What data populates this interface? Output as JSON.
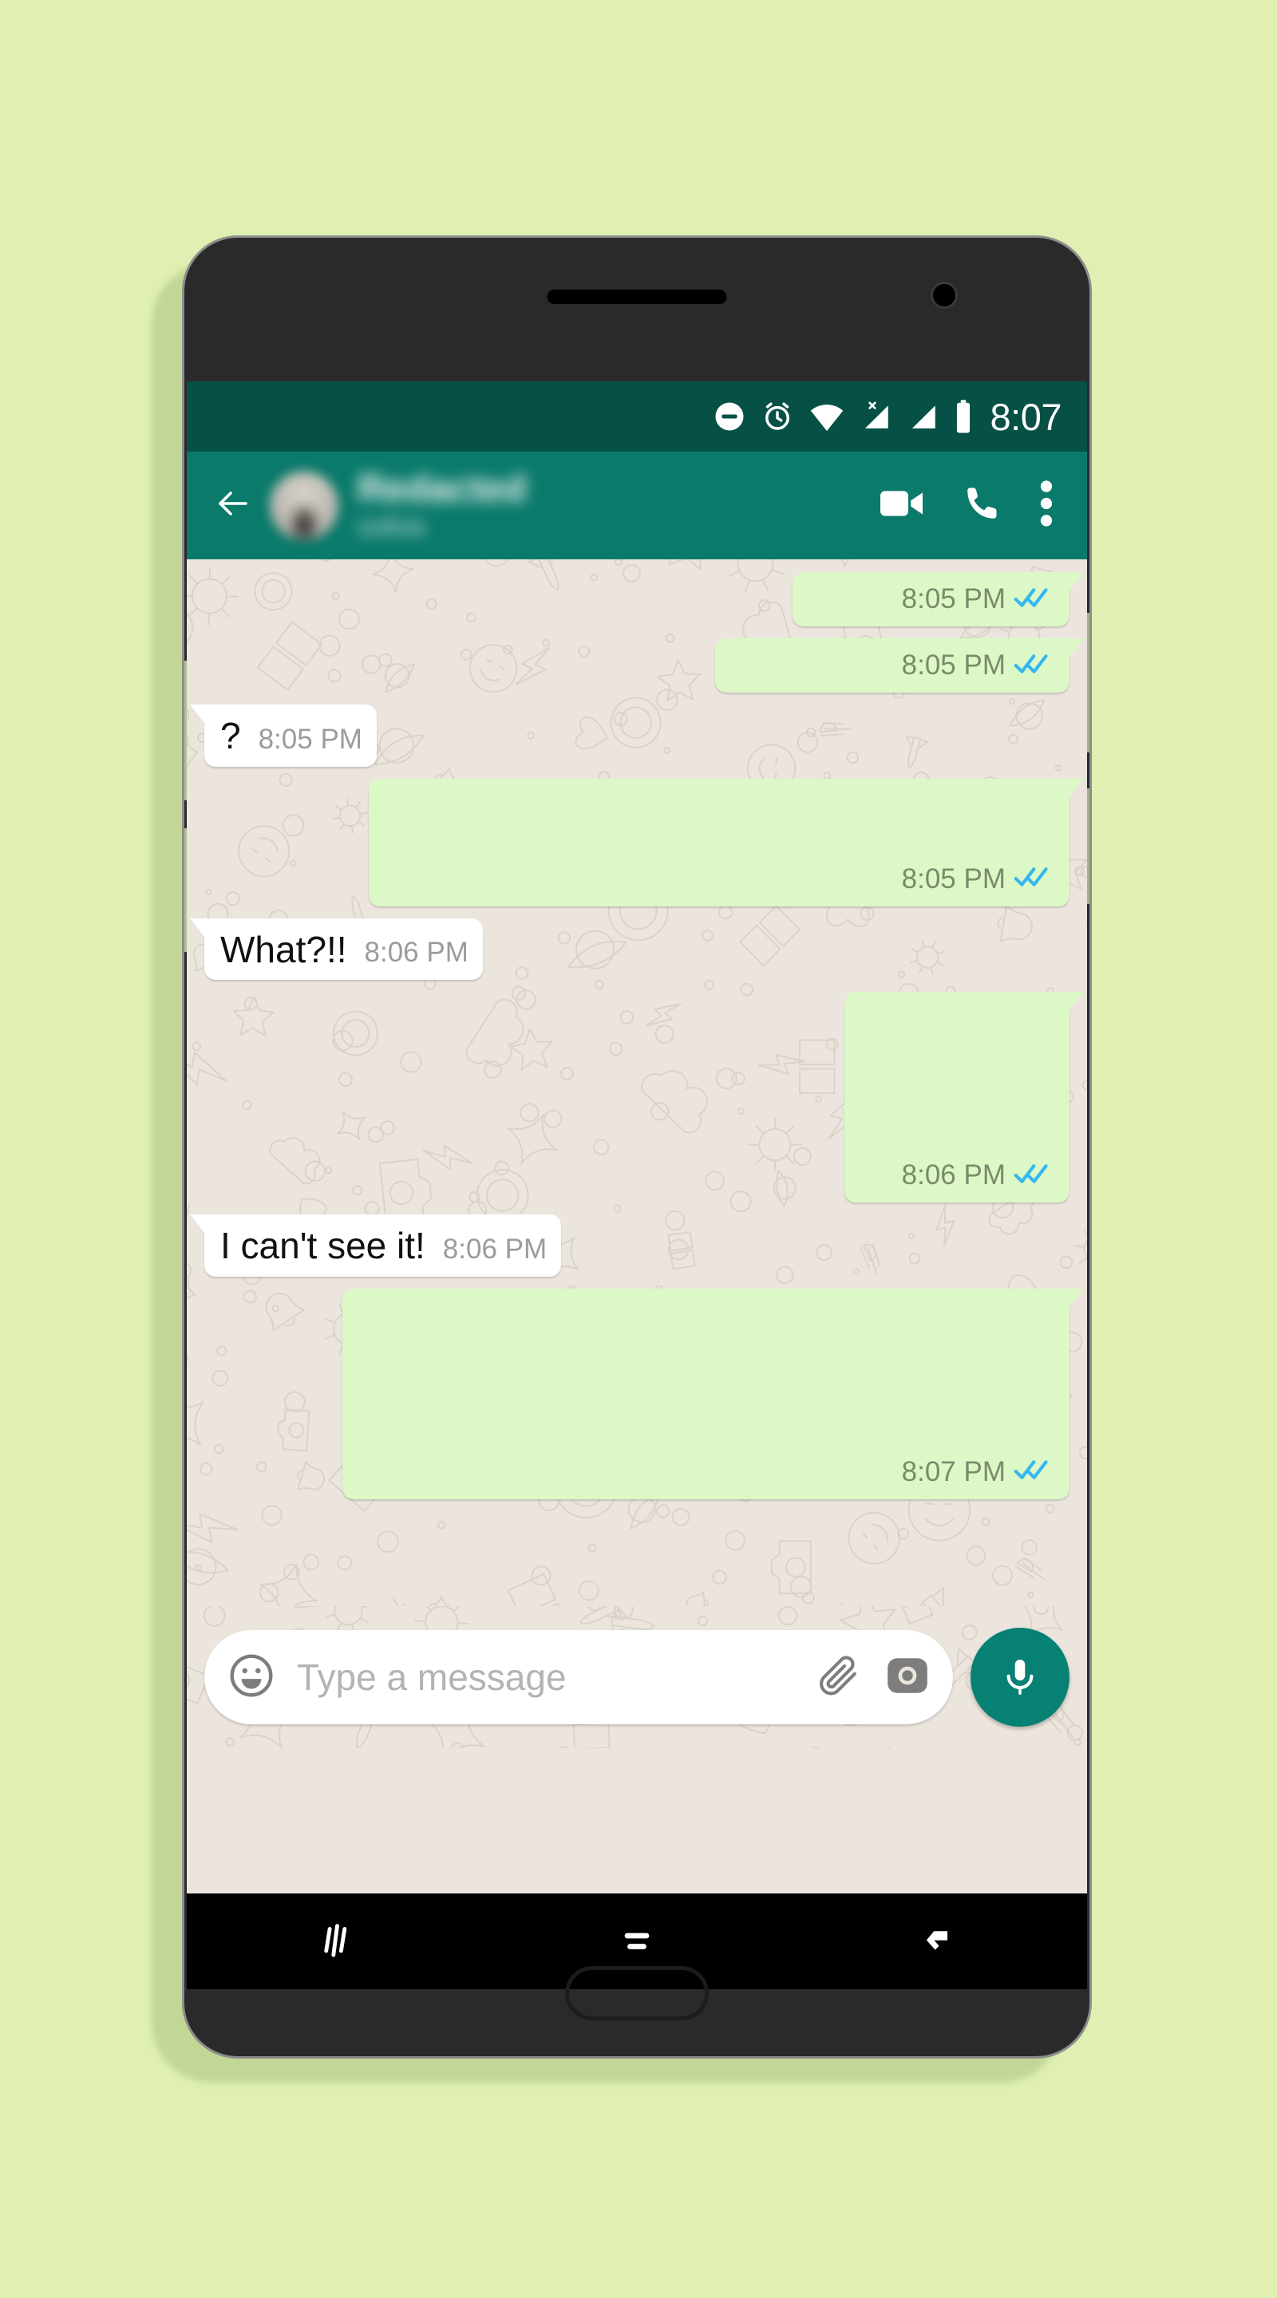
{
  "page": {
    "background_color": "#dff0b2",
    "device": "android-phone-mockup"
  },
  "status_bar": {
    "time": "8:07",
    "background_color": "#075045",
    "icons": [
      "do-not-disturb-icon",
      "alarm-icon",
      "wifi-icon",
      "signal-muted-icon",
      "signal-icon",
      "battery-icon"
    ]
  },
  "app_bar": {
    "background_color": "#0a7a6b",
    "back_label": "Back",
    "contact_name": "Redacted",
    "contact_status": "online",
    "actions": [
      "video-call-icon",
      "voice-call-icon",
      "overflow-menu-icon"
    ]
  },
  "chat": {
    "wallpaper": "whatsapp-doodle-pattern",
    "outgoing_bubble_color": "#dcf8c6",
    "incoming_bubble_color": "#ffffff",
    "tick_color": "#34b7f1",
    "messages": [
      {
        "direction": "out",
        "text": "",
        "time": "8:05 PM",
        "status": "read",
        "width": "32%",
        "height": "normal"
      },
      {
        "direction": "out",
        "text": "",
        "time": "8:05 PM",
        "status": "read",
        "width": "41%",
        "height": "normal"
      },
      {
        "direction": "in",
        "text": "?",
        "time": "8:05 PM",
        "status": "",
        "width": "auto",
        "height": "normal"
      },
      {
        "direction": "out",
        "text": "",
        "time": "8:05 PM",
        "status": "read",
        "width": "81%",
        "height": "tall"
      },
      {
        "direction": "in",
        "text": "What?!!",
        "time": "8:06 PM",
        "status": "",
        "width": "auto",
        "height": "normal"
      },
      {
        "direction": "out",
        "text": "",
        "time": "8:06 PM",
        "status": "read",
        "width": "26%",
        "height": "xtall"
      },
      {
        "direction": "in",
        "text": "I can't see it!",
        "time": "8:06 PM",
        "status": "",
        "width": "auto",
        "height": "normal"
      },
      {
        "direction": "out",
        "text": "",
        "time": "8:07 PM",
        "status": "read",
        "width": "84%",
        "height": "xtall"
      }
    ]
  },
  "input_bar": {
    "placeholder": "Type a message",
    "value": "",
    "emoji_icon": "smiley-icon",
    "attach_icon": "paperclip-icon",
    "camera_icon": "camera-icon",
    "mic_icon": "microphone-icon",
    "mic_button_color": "#078174"
  },
  "nav_bar": {
    "buttons": [
      "recents-button",
      "home-button",
      "back-button"
    ]
  }
}
